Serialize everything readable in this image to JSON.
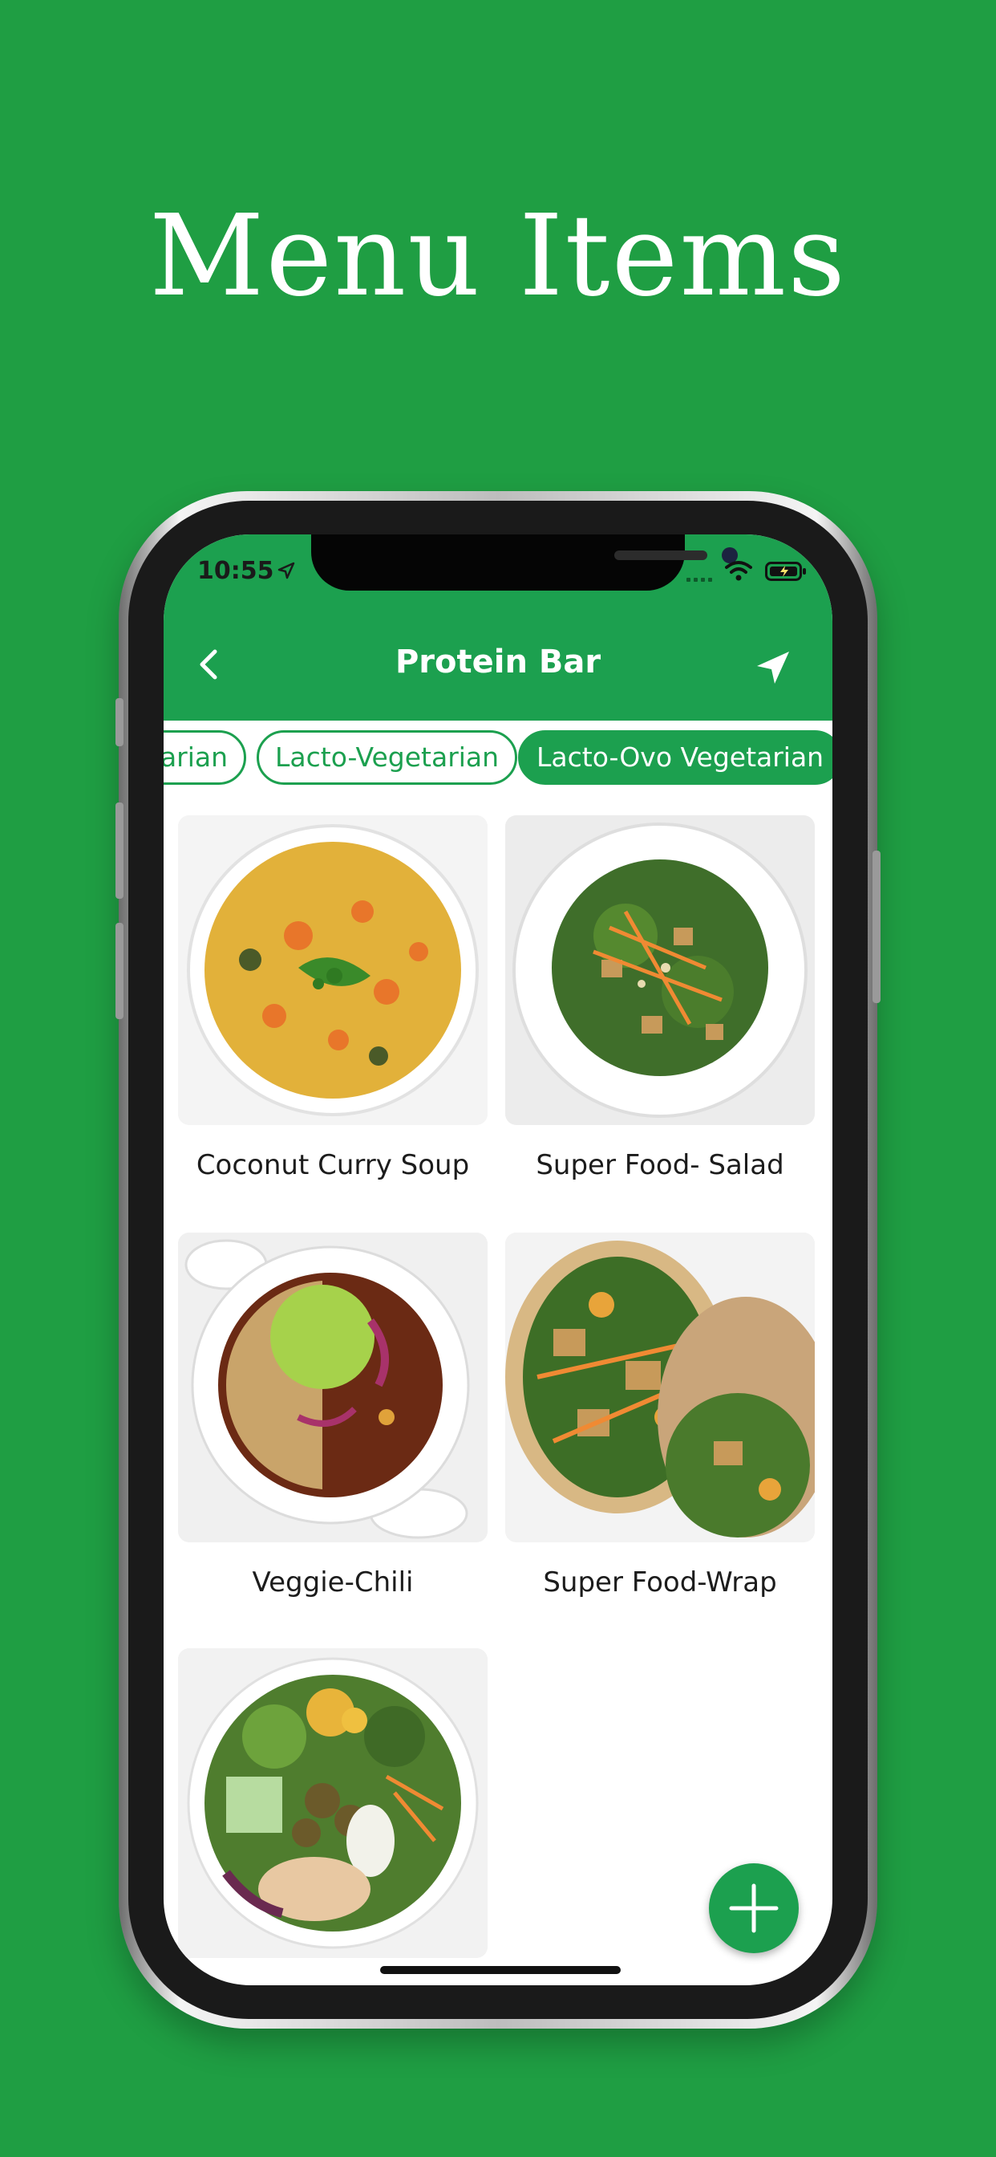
{
  "headline": "Menu Items",
  "status": {
    "time": "10:55"
  },
  "nav": {
    "title": "Protein Bar"
  },
  "chips": [
    {
      "label": "tarian",
      "active": false
    },
    {
      "label": "Lacto-Vegetarian",
      "active": false
    },
    {
      "label": "Lacto-Ovo Vegetarian",
      "active": true
    }
  ],
  "items": [
    {
      "name": "Coconut Curry Soup",
      "image": "curry-soup-bowl"
    },
    {
      "name": "Super Food- Salad",
      "image": "salad-plate"
    },
    {
      "name": "Veggie-Chili",
      "image": "chili-bowl"
    },
    {
      "name": "Super Food-Wrap",
      "image": "wrap-halves"
    },
    {
      "name": "",
      "image": "grain-bowl"
    }
  ],
  "colors": {
    "background": "#1f9e43",
    "accent": "#1ca04f"
  },
  "icons": [
    "location-arrow-icon",
    "wifi-icon",
    "battery-icon",
    "back-chevron-icon",
    "send-location-icon",
    "plus-icon"
  ]
}
